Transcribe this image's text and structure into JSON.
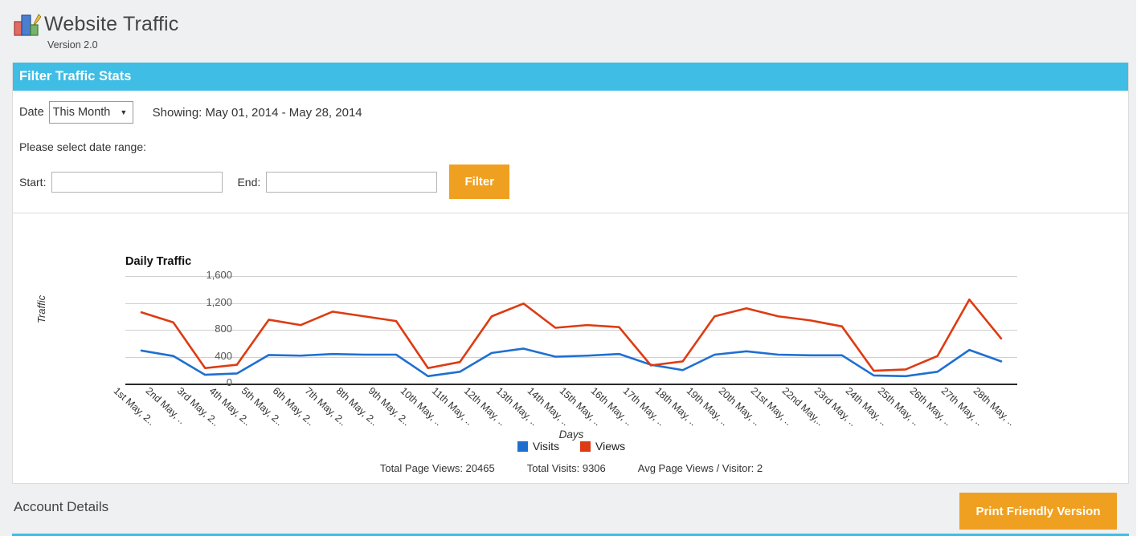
{
  "app": {
    "title": "Website Traffic",
    "version": "Version 2.0",
    "logo_icon": "bar-chart-pencil-icon"
  },
  "filter_panel": {
    "header": "Filter Traffic Stats",
    "date_label": "Date",
    "date_select_value": "This Month",
    "date_select_options": [
      "This Month"
    ],
    "caret_icon": "chevron-down-icon",
    "showing_text": "Showing: May 01, 2014 - May 28, 2014",
    "daterange_hint": "Please select date range:",
    "start_label": "Start:",
    "start_value": "",
    "start_placeholder": "",
    "end_label": "End:",
    "end_value": "",
    "end_placeholder": "",
    "filter_button": "Filter"
  },
  "stats": {
    "total_page_views": "Total Page Views: 20465",
    "total_visits": "Total Visits: 9306",
    "avg_page_views": "Avg Page Views / Visitor: 2"
  },
  "footer": {
    "account_details": "Account Details",
    "print_button": "Print Friendly Version"
  },
  "colors": {
    "accent_blue": "#3fbde4",
    "accent_orange": "#f0a020",
    "series_visits": "#1f6fd0",
    "series_views": "#dd3b12",
    "page_bg": "#eef0f1"
  },
  "chart_data": {
    "type": "line",
    "title": "Daily Traffic",
    "xlabel": "Days",
    "ylabel": "Traffic",
    "ylim": [
      0,
      1600
    ],
    "yticks": [
      0,
      400,
      800,
      1200,
      1600
    ],
    "ytick_labels": [
      "0",
      "400",
      "800",
      "1,200",
      "1,600"
    ],
    "grid": true,
    "legend_position": "bottom",
    "categories": [
      "1st May, 2..",
      "2nd May, ..",
      "3rd May, 2..",
      "4th May, 2..",
      "5th May, 2..",
      "6th May, 2..",
      "7th May, 2..",
      "8th May, 2..",
      "9th May, 2..",
      "10th May, ..",
      "11th May, ..",
      "12th May, ..",
      "13th May, ..",
      "14th May, ..",
      "15th May, ..",
      "16th May, ..",
      "17th May, ..",
      "18th May, ..",
      "19th May, ..",
      "20th May, ..",
      "21st May, ..",
      "22nd May,..",
      "23rd May, ..",
      "24th May, ..",
      "25th May, ..",
      "26th May, ..",
      "27th May, ..",
      "28th May, .."
    ],
    "series": [
      {
        "name": "Visits",
        "color": "#1f6fd0",
        "values": [
          490,
          410,
          130,
          150,
          425,
          415,
          440,
          430,
          430,
          110,
          175,
          455,
          520,
          400,
          415,
          440,
          280,
          200,
          430,
          480,
          430,
          420,
          420,
          120,
          110,
          175,
          500,
          330
        ]
      },
      {
        "name": "Views",
        "color": "#dd3b12",
        "values": [
          1060,
          910,
          230,
          280,
          950,
          870,
          1070,
          1000,
          930,
          230,
          320,
          1000,
          1190,
          830,
          870,
          840,
          270,
          330,
          1000,
          1120,
          1000,
          940,
          850,
          190,
          210,
          410,
          1250,
          670
        ]
      }
    ]
  }
}
